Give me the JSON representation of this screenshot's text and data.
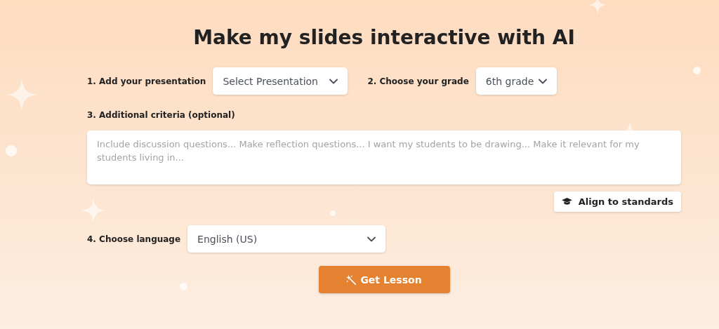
{
  "title": "Make my slides interactive with AI",
  "presentation": {
    "label": "1. Add your presentation",
    "value": "Select Presentation"
  },
  "grade": {
    "label": "2. Choose your grade",
    "value": "6th grade"
  },
  "criteria": {
    "label": "3. Additional criteria (optional)",
    "placeholder": "Include discussion questions... Make reflection questions... I want my students to be drawing... Make it relevant for my students living in..."
  },
  "align_button": "Align to standards",
  "language": {
    "label": "4. Choose language",
    "value": "English (US)"
  },
  "submit_button": "Get Lesson"
}
